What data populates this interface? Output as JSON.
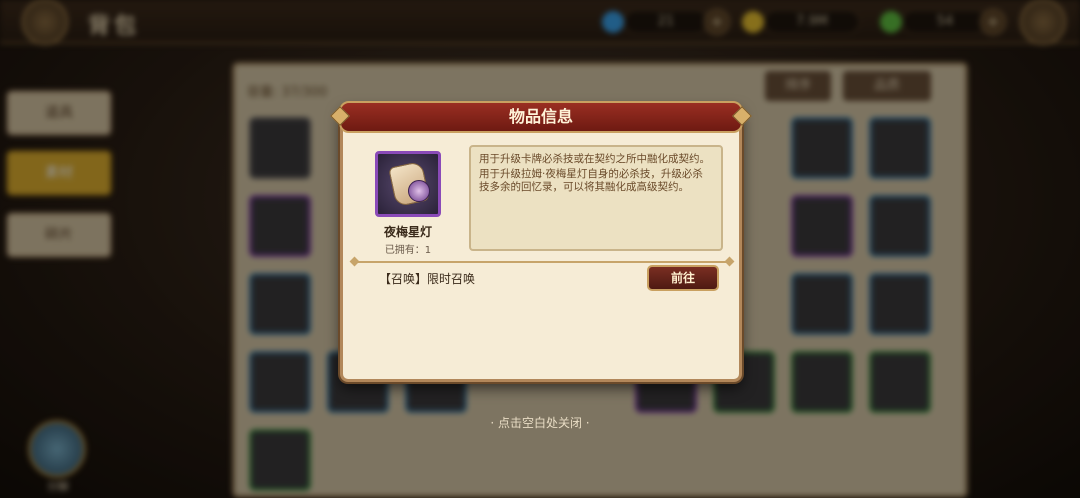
{
  "header": {
    "title": "背包",
    "resources": [
      {
        "name": "diamond",
        "value": "21",
        "color": "#3aa0e8"
      },
      {
        "name": "gold",
        "value": "7.9M",
        "color": "#e8c030"
      },
      {
        "name": "leaf",
        "value": "54",
        "color": "#60c040"
      }
    ]
  },
  "panel": {
    "capacity_label": "容量: 37/300",
    "sort_label": "排序",
    "filter_label": "品质"
  },
  "sidebar": {
    "items": [
      {
        "label": "道具"
      },
      {
        "label": "素材"
      },
      {
        "label": "碎片"
      }
    ]
  },
  "bottom_left": {
    "label": "分解"
  },
  "modal": {
    "title": "物品信息",
    "item_name": "夜梅星灯",
    "owned": "已拥有：1",
    "description": [
      "用于升级卡牌必杀技或在契约之所中融化成契约。",
      "用于升级拉姆·夜梅星灯自身的必杀技，升级必杀技多余的回忆录，可以将其融化成高级契约。"
    ],
    "source": "【召唤】限时召唤",
    "go_button": "前往"
  },
  "close_hint": "· 点击空白处关闭 ·"
}
